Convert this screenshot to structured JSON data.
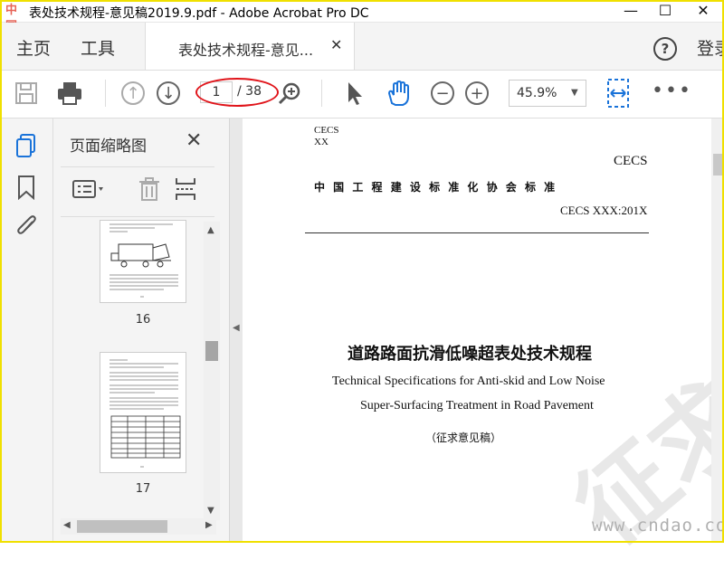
{
  "window": {
    "title": "表处技术规程-意见稿2019.9.pdf - Adobe Acrobat Pro DC",
    "logo_text": "中国"
  },
  "tabs": {
    "home": "主页",
    "tools": "工具",
    "document": "表处技术规程-意见...",
    "login": "登录"
  },
  "toolbar": {
    "current_page": "1",
    "total_pages": "/ 38",
    "zoom": "45.9%"
  },
  "sidebar_panel": {
    "title": "页面缩略图",
    "thumbnails": [
      {
        "page_label": "16"
      },
      {
        "page_label": "17"
      }
    ]
  },
  "document": {
    "corner_code_1": "CECS",
    "corner_code_2": "XX",
    "org_code": "CECS",
    "org_name": "中 国 工 程 建 设 标 准 化 协 会 标 准",
    "std_number": "CECS XXX:201X",
    "title_cn": "道路路面抗滑低噪超表处技术规程",
    "title_en_line1": "Technical Specifications for Anti-skid and Low Noise",
    "title_en_line2": "Super-Surfacing Treatment in Road Pavement",
    "draft_note": "（征求意见稿）",
    "watermark_text": "征求意见稿"
  },
  "site_watermark": "www.cndao.com",
  "colors": {
    "accent_blue": "#1a73d9",
    "annotation_red": "#e0141a",
    "frame_yellow": "#f0e000"
  },
  "icons": [
    "app-logo",
    "minimize",
    "maximize",
    "close",
    "help",
    "save",
    "print",
    "prev-page",
    "next-page",
    "zoom-search",
    "select-cursor",
    "hand-tool",
    "zoom-out",
    "zoom-in",
    "fit-page",
    "more",
    "page-thumbnails",
    "bookmark",
    "attachment",
    "options-menu",
    "delete",
    "insert"
  ]
}
